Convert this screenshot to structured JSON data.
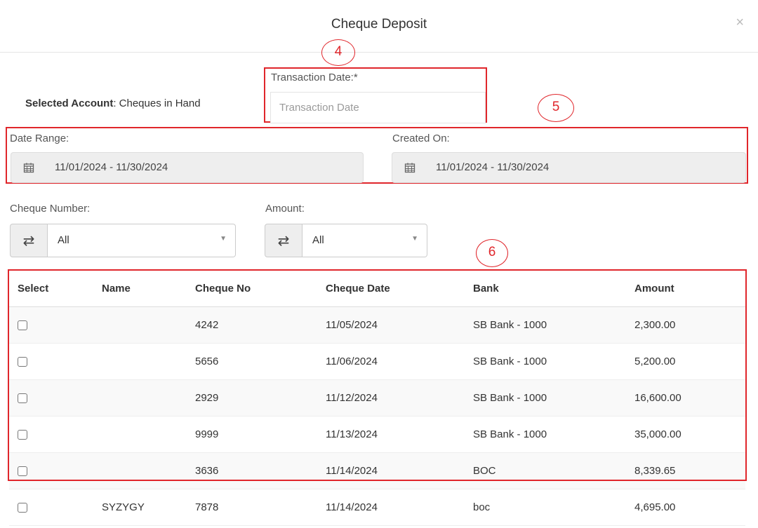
{
  "modal": {
    "title": "Cheque Deposit",
    "close_symbol": "×"
  },
  "annotations": {
    "a4": "4",
    "a5": "5",
    "a6": "6",
    "color": "#e0262b"
  },
  "selected_account": {
    "label": "Selected Account",
    "value": ": Cheques in Hand"
  },
  "transaction_date": {
    "label": "Transaction Date:*",
    "placeholder": "Transaction Date"
  },
  "date_range": {
    "label": "Date Range:",
    "value": "11/01/2024 - 11/30/2024"
  },
  "created_on": {
    "label": "Created On:",
    "value": "11/01/2024 - 11/30/2024"
  },
  "cheque_number": {
    "label": "Cheque Number:",
    "value": "All"
  },
  "amount_filter": {
    "label": "Amount:",
    "value": "All"
  },
  "table": {
    "headers": [
      "Select",
      "Name",
      "Cheque No",
      "Cheque Date",
      "Bank",
      "Amount"
    ],
    "rows": [
      {
        "name": "",
        "cheque_no": "4242",
        "date": "11/05/2024",
        "bank": "SB Bank - 1000",
        "amount": "2,300.00"
      },
      {
        "name": "",
        "cheque_no": "5656",
        "date": "11/06/2024",
        "bank": "SB Bank - 1000",
        "amount": "5,200.00"
      },
      {
        "name": "",
        "cheque_no": "2929",
        "date": "11/12/2024",
        "bank": "SB Bank - 1000",
        "amount": "16,600.00"
      },
      {
        "name": "",
        "cheque_no": "9999",
        "date": "11/13/2024",
        "bank": "SB Bank - 1000",
        "amount": "35,000.00"
      },
      {
        "name": "",
        "cheque_no": "3636",
        "date": "11/14/2024",
        "bank": "BOC",
        "amount": "8,339.65"
      },
      {
        "name": "SYZYGY",
        "cheque_no": "7878",
        "date": "11/14/2024",
        "bank": "boc",
        "amount": "4,695.00"
      }
    ]
  }
}
